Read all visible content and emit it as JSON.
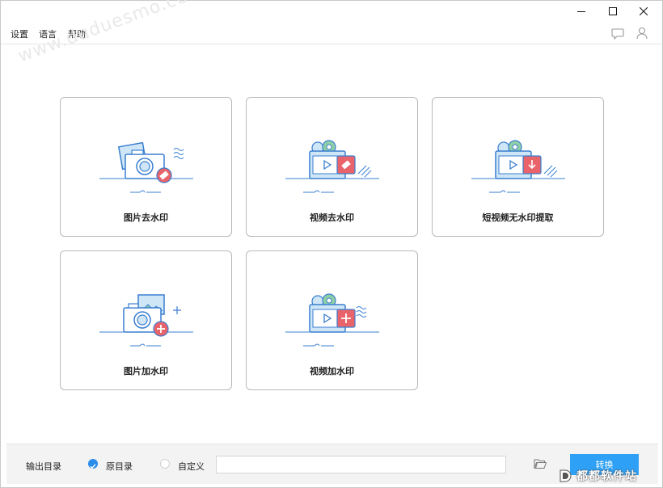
{
  "window": {
    "controls": [
      "minimize-icon",
      "maximize-icon",
      "close-icon"
    ]
  },
  "menu": {
    "items": [
      {
        "label": "设置"
      },
      {
        "label": "语言"
      },
      {
        "label": "帮助"
      }
    ],
    "right_icons": [
      "chat-bubble-icon",
      "user-icon"
    ]
  },
  "watermark": "www.duduesmo.com",
  "features": [
    {
      "label": "图片去水印",
      "icon": "image-remove-watermark-icon"
    },
    {
      "label": "视频去水印",
      "icon": "video-remove-watermark-icon"
    },
    {
      "label": "短视频无水印提取",
      "icon": "short-video-extract-icon"
    },
    {
      "label": "图片加水印",
      "icon": "image-add-watermark-icon"
    },
    {
      "label": "视频加水印",
      "icon": "video-add-watermark-icon"
    }
  ],
  "footer": {
    "output_label": "输出目录",
    "option_original": "原目录",
    "option_custom": "自定义",
    "selected": "original",
    "path_value": "",
    "convert_label": "转换"
  },
  "brand": {
    "text": "都都软件站"
  },
  "colors": {
    "accent": "#2ea0f5",
    "radio_selected": "#2a8ceb",
    "icon_blue": "#3a7fd0",
    "icon_red": "#e9636a",
    "icon_green": "#8fcfa6"
  }
}
